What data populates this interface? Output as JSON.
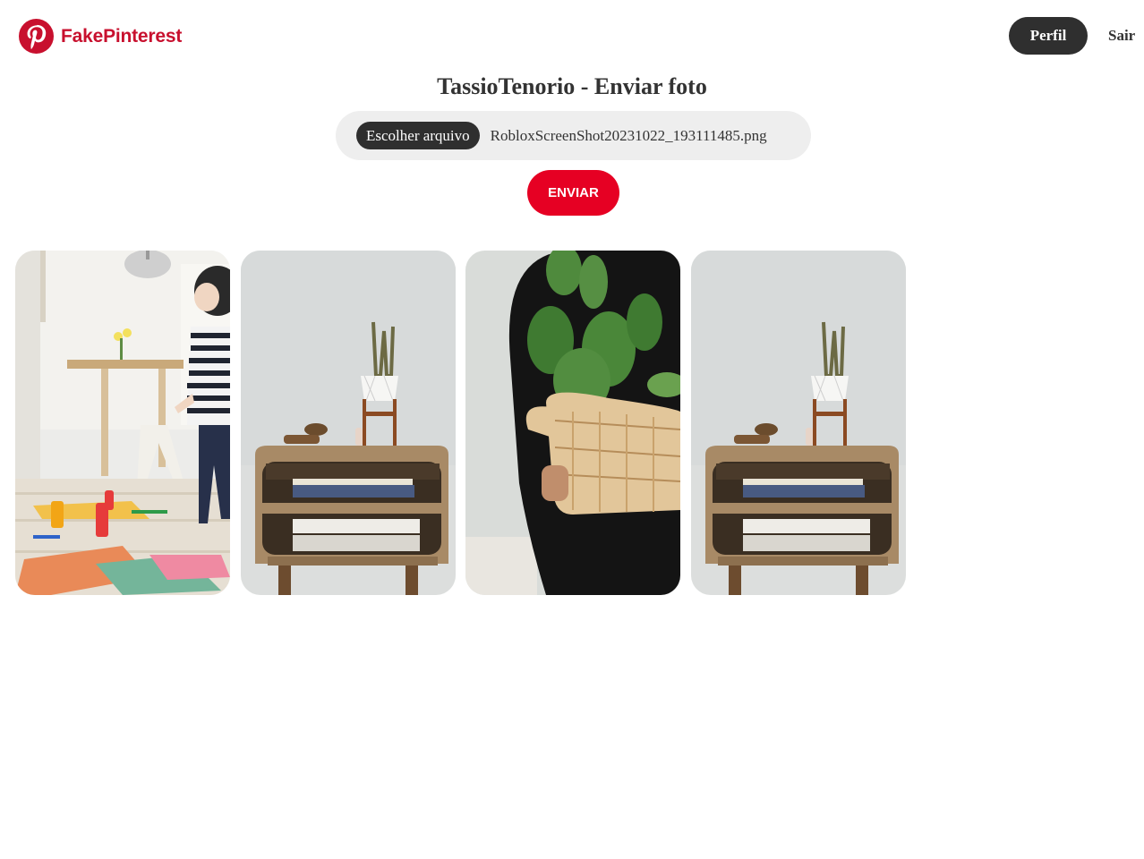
{
  "navbar": {
    "brand_name": "FakePinterest",
    "brand_color": "#c8102e",
    "logo_icon": "pinterest-logo-icon",
    "profile_label": "Perfil",
    "logout_label": "Sair"
  },
  "upload": {
    "title": "TassioTenorio - Enviar foto",
    "choose_file_label": "Escolher arquivo",
    "file_name": "RobloxScreenShot20231022_193111485.png",
    "submit_label": "ENVIAR",
    "submit_color": "#e60023"
  },
  "gallery": {
    "photos": [
      {
        "subject": "child playing with paper on floor"
      },
      {
        "subject": "wooden nightstand with books and plant"
      },
      {
        "subject": "person holding cactus in woven basket"
      },
      {
        "subject": "wooden nightstand with books and plant"
      }
    ]
  }
}
